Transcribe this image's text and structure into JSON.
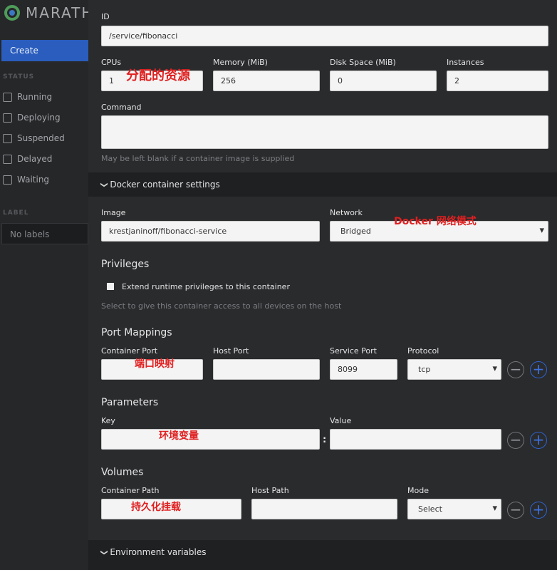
{
  "sidebar": {
    "logo_text": "MARATH",
    "create_label": "Create",
    "status_heading": "STATUS",
    "filters": [
      "Running",
      "Deploying",
      "Suspended",
      "Delayed",
      "Waiting"
    ],
    "label_heading": "LABEL",
    "labels_placeholder": "No labels"
  },
  "form": {
    "id_label": "ID",
    "id_value": "/service/fibonacci",
    "cpus_label": "CPUs",
    "cpus_value": "1",
    "memory_label": "Memory (MiB)",
    "memory_value": "256",
    "disk_label": "Disk Space (MiB)",
    "disk_value": "0",
    "instances_label": "Instances",
    "instances_value": "2",
    "command_label": "Command",
    "command_help": "May be left blank if a container image is supplied"
  },
  "docker": {
    "title": "Docker container settings",
    "image_label": "Image",
    "image_value": "krestjaninoff/fibonacci-service",
    "network_label": "Network",
    "network_value": "Bridged",
    "privileges_title": "Privileges",
    "privileges_checkbox": "Extend runtime privileges to this container",
    "privileges_help": "Select to give this container access to all devices on the host",
    "ports_title": "Port Mappings",
    "container_port_label": "Container Port",
    "host_port_label": "Host Port",
    "service_port_label": "Service Port",
    "service_port_value": "8099",
    "protocol_label": "Protocol",
    "protocol_value": "tcp",
    "parameters_title": "Parameters",
    "key_label": "Key",
    "value_label": "Value",
    "colon": ":",
    "volumes_title": "Volumes",
    "container_path_label": "Container Path",
    "host_path_label": "Host Path",
    "mode_label": "Mode",
    "mode_value": "Select"
  },
  "env": {
    "title": "Environment variables"
  },
  "buttons": {
    "minus": "−",
    "plus": "+"
  },
  "annotations": {
    "resources": "分配的资源",
    "network_mode": "Docker 网络模式",
    "port_mapping": "端口映射",
    "env_vars": "环境变量",
    "persistence": "持久化挂载"
  },
  "colors": {
    "annotation": "#e02020",
    "accent": "#2a5dbd"
  }
}
